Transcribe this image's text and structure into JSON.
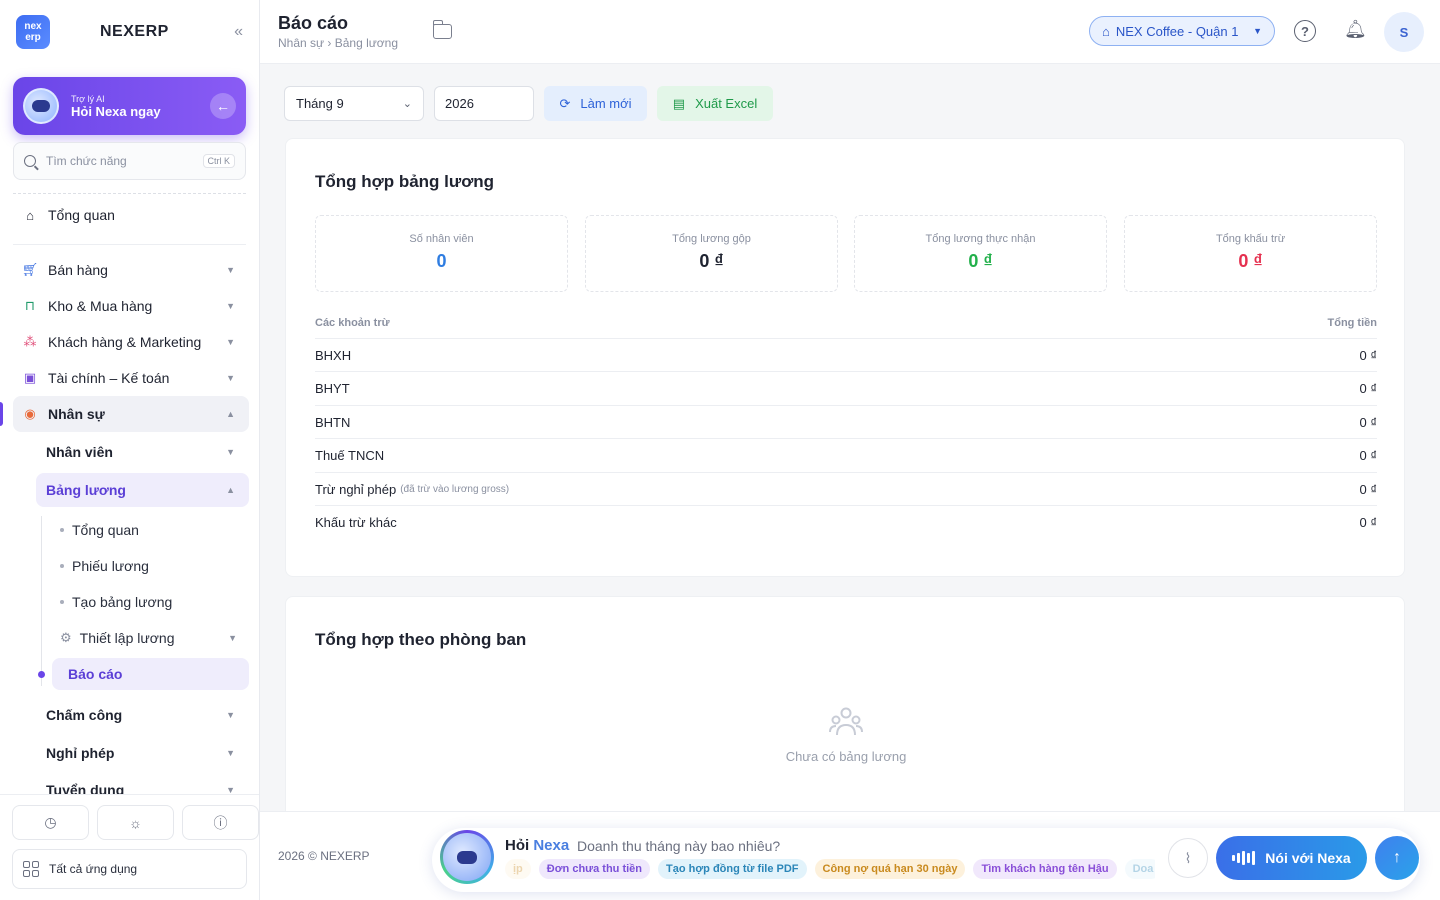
{
  "sidebar": {
    "brand": "NEXERP",
    "logo_text": "nex erp",
    "ai_card": {
      "small": "Trợ lý AI",
      "big": "Hỏi Nexa ngay"
    },
    "search": {
      "placeholder": "Tìm chức năng",
      "shortcut": "Ctrl K"
    },
    "overview": "Tổng quan",
    "items": [
      {
        "label": "Bán hàng"
      },
      {
        "label": "Kho & Mua hàng"
      },
      {
        "label": "Khách hàng & Marketing"
      },
      {
        "label": "Tài chính – Kế toán"
      },
      {
        "label": "Nhân sự"
      }
    ],
    "hr_sub": {
      "employees": "Nhân viên",
      "payroll": "Bảng lương",
      "payroll_children": [
        "Tổng quan",
        "Phiếu lương",
        "Tạo bảng lương",
        "Thiết lập lương",
        "Báo cáo"
      ],
      "attendance": "Chấm công",
      "leave": "Nghỉ phép",
      "recruit": "Tuyển dụng"
    },
    "all_apps": "Tất cả ứng dụng"
  },
  "header": {
    "title": "Báo cáo",
    "breadcrumb": "Nhân sự › Bảng lương",
    "store": "NEX Coffee - Quận 1",
    "avatar_initial": "S"
  },
  "toolbar": {
    "month": "Tháng 9",
    "year": "2026",
    "refresh_label": "Làm mới",
    "export_label": "Xuất Excel"
  },
  "summary": {
    "title": "Tổng hợp bảng lương",
    "stats": [
      {
        "label": "Số nhân viên",
        "value": "0",
        "color": "#2f7de1"
      },
      {
        "label": "Tổng lương gộp",
        "value": "0 ₫",
        "color": "#1f2330"
      },
      {
        "label": "Tổng lương thực nhận",
        "value": "0 ₫",
        "color": "#22b04b"
      },
      {
        "label": "Tổng khấu trừ",
        "value": "0 ₫",
        "color": "#e5304f"
      }
    ],
    "table": {
      "col_item": "Các khoản trừ",
      "col_total": "Tổng tiền",
      "rows": [
        {
          "name": "BHXH",
          "note": "",
          "amount": "0 ₫"
        },
        {
          "name": "BHYT",
          "note": "",
          "amount": "0 ₫"
        },
        {
          "name": "BHTN",
          "note": "",
          "amount": "0 ₫"
        },
        {
          "name": "Thuế TNCN",
          "note": "",
          "amount": "0 ₫"
        },
        {
          "name": "Trừ nghỉ phép",
          "note": "(đã trừ vào lương gross)",
          "amount": "0 ₫"
        },
        {
          "name": "Khấu trừ khác",
          "note": "",
          "amount": "0 ₫"
        }
      ]
    }
  },
  "department": {
    "title": "Tổng hợp theo phòng ban",
    "empty_text": "Chưa có bảng lương"
  },
  "footer": {
    "copyright": "2026 © NEXERP",
    "chat_title_a": "Hỏi",
    "chat_title_b": "Nexa",
    "chat_prompt": "Doanh thu tháng này bao nhiêu?",
    "chips": [
      {
        "label": "ịp",
        "bg": "#fdf1dc",
        "fg": "#c98a1e",
        "fade": true
      },
      {
        "label": "Đơn chưa thu tiền",
        "bg": "#efe8fc",
        "fg": "#7a4fd8",
        "fade": false
      },
      {
        "label": "Tạo hợp đồng từ file PDF",
        "bg": "#e2f3fb",
        "fg": "#2b86b8",
        "fade": false
      },
      {
        "label": "Công nợ quá hạn 30 ngày",
        "bg": "#fdf1dc",
        "fg": "#c98a1e",
        "fade": false
      },
      {
        "label": "Tìm khách hàng tên Hậu",
        "bg": "#f1e8fc",
        "fg": "#8a4fd8",
        "fade": false
      },
      {
        "label": "Doa",
        "bg": "#e2f3fb",
        "fg": "#2b86b8",
        "fade": true
      }
    ],
    "voice_label": "Nói với Nexa"
  }
}
